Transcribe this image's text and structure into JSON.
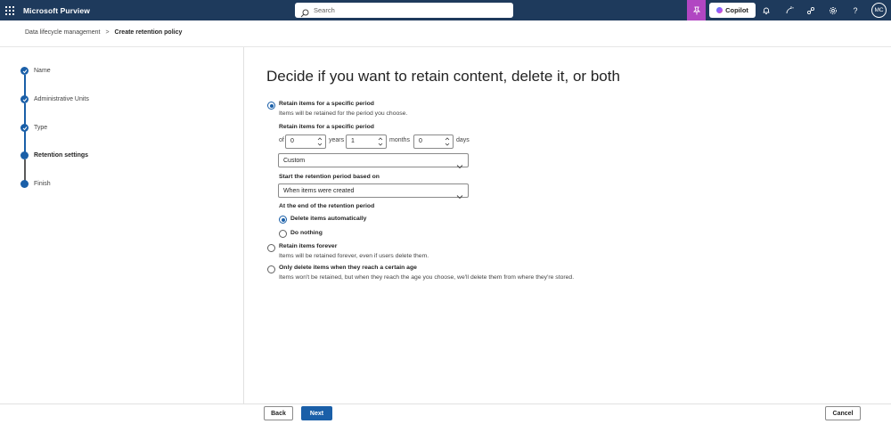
{
  "app": {
    "title": "Microsoft Purview",
    "search_placeholder": "Search",
    "copilot_label": "Copilot",
    "avatar_initials": "MC"
  },
  "breadcrumb": {
    "parent": "Data lifecycle management",
    "separator": ">",
    "current": "Create retention policy"
  },
  "steps": [
    {
      "label": "Name",
      "state": "complete"
    },
    {
      "label": "Administrative Units",
      "state": "complete"
    },
    {
      "label": "Type",
      "state": "complete"
    },
    {
      "label": "Retention settings",
      "state": "current"
    },
    {
      "label": "Finish",
      "state": "pending"
    }
  ],
  "main": {
    "title": "Decide if you want to retain content, delete it, or both",
    "option_retain_period": {
      "title": "Retain items for a specific period",
      "desc": "Items will be retained for the period you choose.",
      "selected": true
    },
    "period": {
      "label": "Retain items for a specific period",
      "prefix": "of",
      "years_value": "0",
      "years_unit": "years",
      "months_value": "1",
      "months_unit": "months",
      "days_value": "0",
      "days_unit": "days",
      "preset_value": "Custom"
    },
    "start_based_on": {
      "label": "Start the retention period based on",
      "value": "When items were created"
    },
    "end_of_period": {
      "label": "At the end of the retention period",
      "option_delete": "Delete items automatically",
      "option_nothing": "Do nothing",
      "selected": "delete"
    },
    "option_retain_forever": {
      "title": "Retain items forever",
      "desc": "Items will be retained forever, even if users delete them.",
      "selected": false
    },
    "option_delete_only": {
      "title": "Only delete items when they reach a certain age",
      "desc": "Items won't be retained, but when they reach the age you choose, we'll delete them from where they're stored.",
      "selected": false
    }
  },
  "footer": {
    "back_label": "Back",
    "next_label": "Next",
    "cancel_label": "Cancel"
  },
  "colors": {
    "topbar": "#1e3a5c",
    "accent": "#1a5fa8",
    "copilot_active": "#b146c2"
  }
}
